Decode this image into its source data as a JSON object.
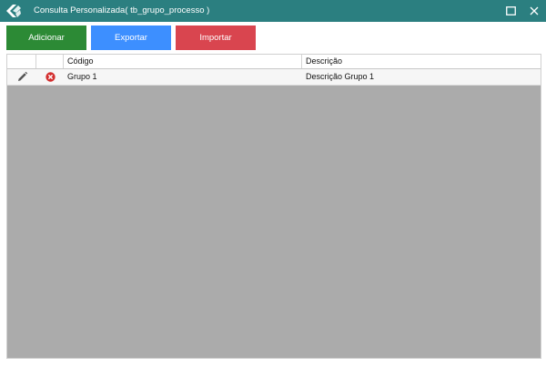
{
  "window": {
    "title": "Consulta Personalizada( tb_grupo_processo )",
    "title_bar_color": "#2b7f80",
    "icons": {
      "logo": "app-logo-icon",
      "maximize": "maximize-icon",
      "close": "close-icon"
    }
  },
  "toolbar": {
    "add_label": "Adicionar",
    "export_label": "Exportar",
    "import_label": "Importar",
    "colors": {
      "add": "#2c8a35",
      "export": "#3d8fff",
      "import": "#d9454f"
    }
  },
  "grid": {
    "columns": [
      "",
      "",
      "Código",
      "Descrição"
    ],
    "rows": [
      {
        "edit_icon": "pencil-icon",
        "delete_icon": "delete-icon",
        "codigo": "Grupo 1",
        "descricao": "Descrição Grupo 1"
      }
    ],
    "empty_area_color": "#ababab"
  }
}
